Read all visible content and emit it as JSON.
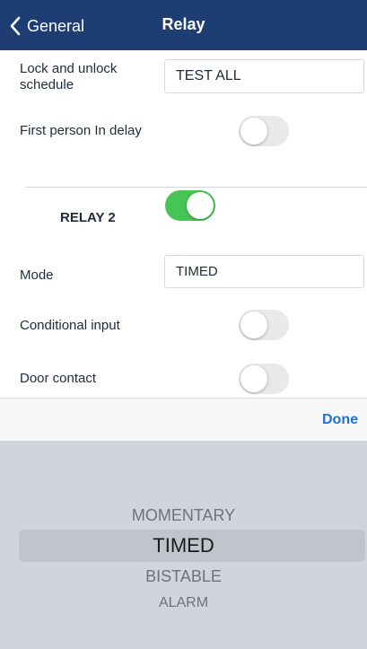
{
  "navbar": {
    "back_label": "General",
    "title": "Relay",
    "background": "#1e3d73"
  },
  "schedule": {
    "label": "Lock and unlock schedule",
    "value": "TEST ALL"
  },
  "first_person_delay": {
    "label": "First person In delay",
    "enabled": false
  },
  "relay2": {
    "title": "RELAY 2",
    "enabled": true,
    "mode_label": "Mode",
    "mode_value": "TIMED",
    "conditional_input_label": "Conditional input",
    "conditional_input_enabled": false,
    "door_contact_label": "Door contact",
    "door_contact_enabled": false
  },
  "toolbar": {
    "done_label": "Done",
    "accent": "#1a73d9"
  },
  "picker": {
    "options": [
      "MOMENTARY",
      "TIMED",
      "BISTABLE",
      "ALARM"
    ],
    "selected": "TIMED"
  },
  "colors": {
    "toggle_on": "#46c454",
    "toggle_off": "#e8e9eb"
  }
}
